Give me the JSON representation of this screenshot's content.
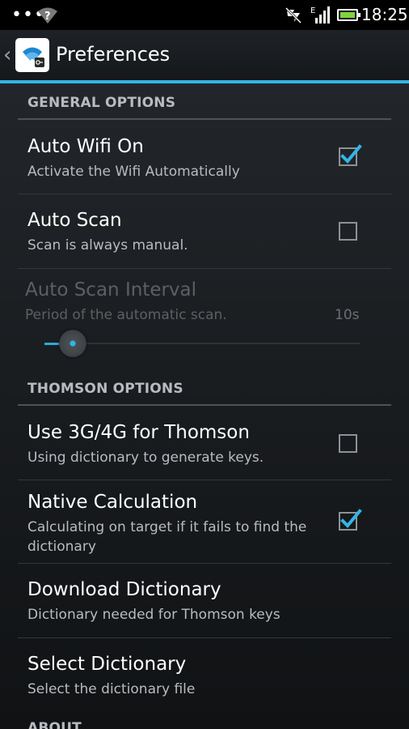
{
  "status_bar": {
    "time": "18:25",
    "signal_letter": "E",
    "icons": [
      "overflow-dots-icon",
      "wifi-question-icon",
      "sync-disabled-icon",
      "signal-icon",
      "battery-icon"
    ]
  },
  "action_bar": {
    "title": "Preferences",
    "icon": "wifi-key-app-icon"
  },
  "sections": {
    "general": {
      "header": "GENERAL OPTIONS",
      "items": [
        {
          "title": "Auto Wifi On",
          "summary": "Activate the Wifi Automatically",
          "checked": true
        },
        {
          "title": "Auto Scan",
          "summary": "Scan is always manual.",
          "checked": false
        },
        {
          "title": "Auto Scan Interval",
          "summary": "Period of the automatic scan.",
          "value": "10s",
          "enabled": false,
          "slider_fraction": 0.09
        }
      ]
    },
    "thomson": {
      "header": "THOMSON OPTIONS",
      "items": [
        {
          "title": "Use 3G/4G for Thomson",
          "summary": "Using dictionary to generate keys.",
          "checked": false
        },
        {
          "title": "Native Calculation",
          "summary": "Calculating on target if it fails to find the dictionary",
          "checked": true
        },
        {
          "title": "Download Dictionary",
          "summary": "Dictionary needed for Thomson keys"
        },
        {
          "title": "Select Dictionary",
          "summary": "Select the dictionary file"
        }
      ]
    },
    "about": {
      "header": "ABOUT"
    }
  },
  "colors": {
    "accent": "#33b5e5",
    "background": "#1a1d20",
    "battery": "#7fd33c"
  }
}
